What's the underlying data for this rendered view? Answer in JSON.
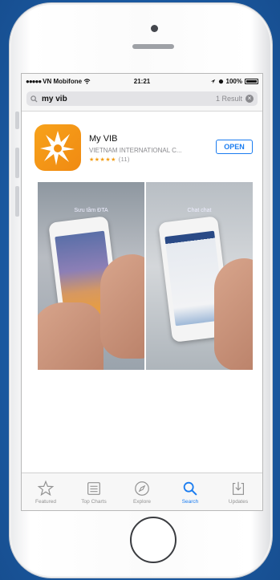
{
  "status_bar": {
    "carrier": "VN Mobifone",
    "time": "21:21",
    "battery": "100%"
  },
  "search": {
    "query": "my vib",
    "result_count": "1 Result"
  },
  "app": {
    "name": "My VIB",
    "developer": "VIETNAM INTERNATIONAL C...",
    "stars": "★★★★★",
    "rating_count": "(11)",
    "action_label": "OPEN",
    "brand_color": "#f7a21b"
  },
  "screenshots": [
    {
      "caption": "Sưu tầm ĐTA"
    },
    {
      "caption": "Chat chat"
    }
  ],
  "tabs": [
    {
      "label": "Featured",
      "icon": "star-icon",
      "active": false
    },
    {
      "label": "Top Charts",
      "icon": "list-icon",
      "active": false
    },
    {
      "label": "Explore",
      "icon": "compass-icon",
      "active": false
    },
    {
      "label": "Search",
      "icon": "search-icon",
      "active": true
    },
    {
      "label": "Updates",
      "icon": "download-icon",
      "active": false
    }
  ],
  "colors": {
    "accent": "#1a7cf0",
    "background": "#1d5fa9"
  }
}
